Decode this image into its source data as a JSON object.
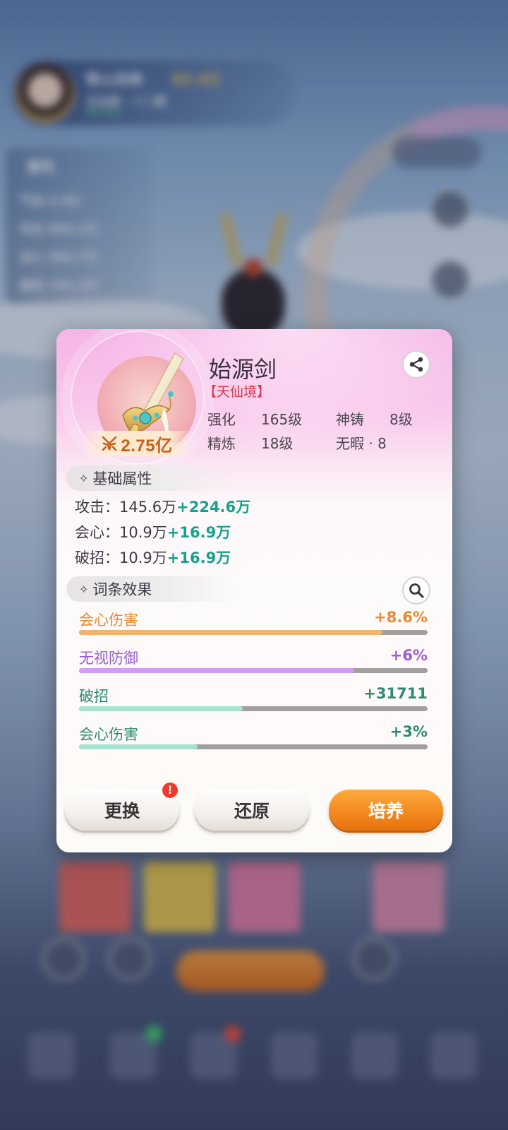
{
  "colors": {
    "accent_orange": "#f38a1f",
    "plus_value": "#1aa08e",
    "grade_red": "#e0334a",
    "power_text": "#c5611b"
  },
  "item": {
    "name": "始源剑",
    "grade": "【天仙境】",
    "power": "2.75亿",
    "icon": "sword-icon",
    "stats": [
      {
        "label": "强化",
        "value": "165级"
      },
      {
        "label": "神铸",
        "value": "8级"
      },
      {
        "label": "精炼",
        "value": "18级"
      },
      {
        "label": "无暇 · 8",
        "value": ""
      }
    ]
  },
  "sections": {
    "base_title": "基础属性",
    "affix_title": "词条效果"
  },
  "base_attributes": [
    {
      "label": "攻击：",
      "base": "145.6万",
      "plus": "+224.6万"
    },
    {
      "label": "会心：",
      "base": "10.9万",
      "plus": "+16.9万"
    },
    {
      "label": "破招：",
      "base": "10.9万",
      "plus": "+16.9万"
    }
  ],
  "affixes": [
    {
      "name": "会心伤害",
      "value": "+8.6%",
      "fill": 0.87,
      "color": "#f0b36b",
      "text_color": "#e98b34"
    },
    {
      "name": "无视防御",
      "value": "+6%",
      "fill": 0.79,
      "color": "#cf9ef0",
      "text_color": "#9a5fd1"
    },
    {
      "name": "破招",
      "value": "+31711",
      "fill": 0.47,
      "color": "#a6e3d0",
      "text_color": "#2e8a74"
    },
    {
      "name": "会心伤害",
      "value": "+3%",
      "fill": 0.34,
      "color": "#a6e3d0",
      "text_color": "#2e8a74"
    }
  ],
  "buttons": {
    "replace": "更换",
    "restore": "还原",
    "train": "培养",
    "alert": "!"
  }
}
